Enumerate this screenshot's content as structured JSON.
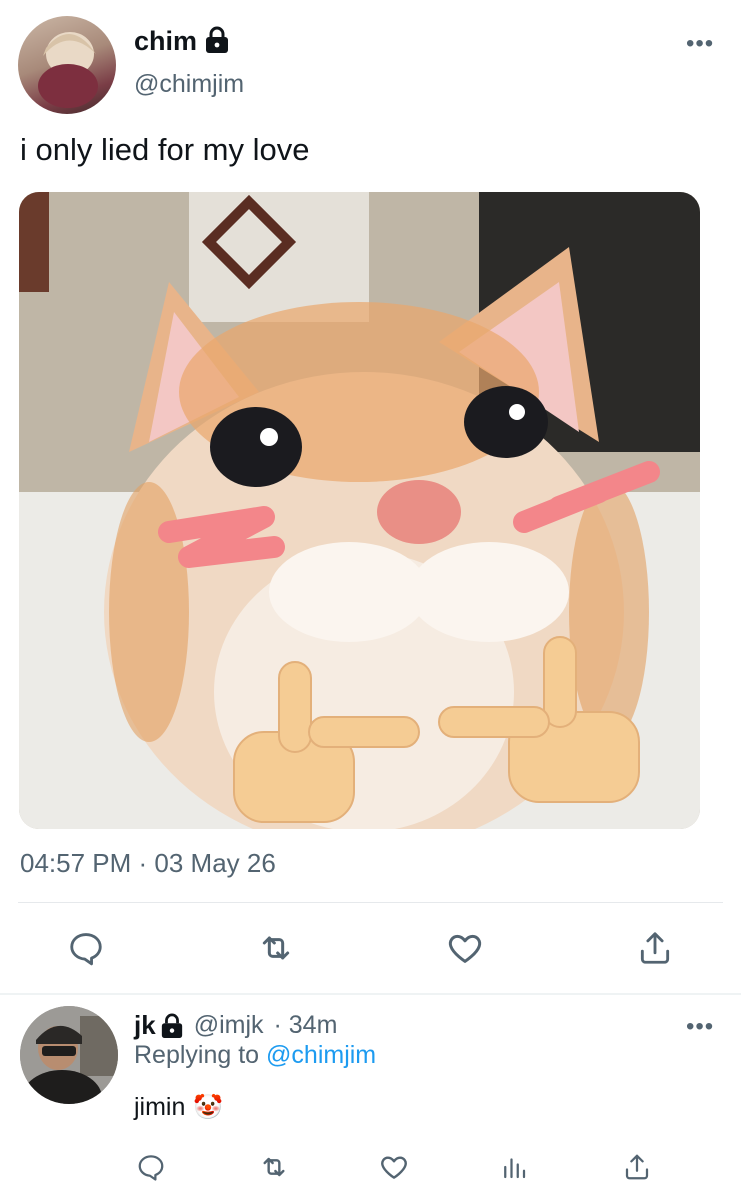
{
  "tweet": {
    "author_name": "chim",
    "author_handle": "@chimjim",
    "text": "i only lied for my love",
    "timestamp": "04:57 PM · 03 May 26",
    "avatar_icon": "avatar-photo",
    "lock_icon": "lock-icon",
    "image_desc_icon": "cat-photo"
  },
  "actions": [
    "reply-icon",
    "retweet-icon",
    "like-icon",
    "share-icon"
  ],
  "reply": {
    "author_name": "jk",
    "author_handle": "@imjk",
    "time": "· 34m",
    "replying_prefix": "Replying to",
    "replying_to": "@chimjim",
    "text": "jimin",
    "emoji": "🤡"
  },
  "reply_actions": [
    "reply-icon",
    "retweet-icon",
    "like-icon",
    "analytics-icon",
    "share-icon"
  ],
  "colors": {
    "link": "#1d9bf0",
    "secondary": "#536471",
    "blush": "#f3868a",
    "fur": "#e8a56b"
  }
}
